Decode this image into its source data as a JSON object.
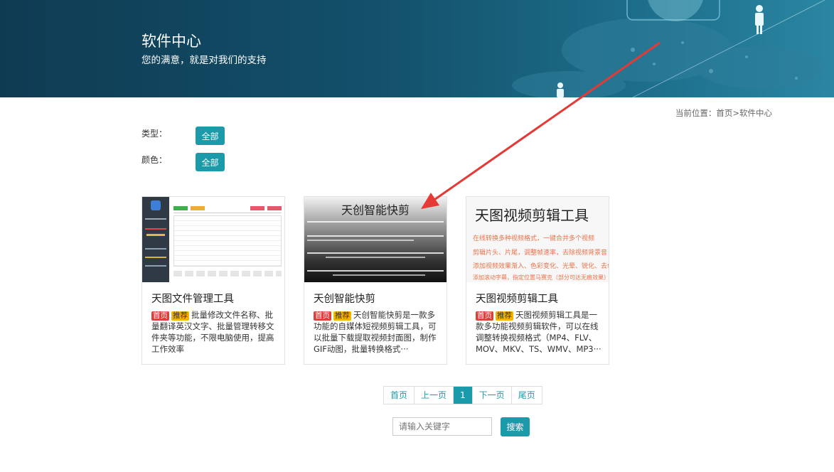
{
  "banner": {
    "title": "软件中心",
    "subtitle": "您的满意，就是对我们的支持"
  },
  "breadcrumb": {
    "prefix": "当前位置：",
    "home": "首页",
    "sep": ">",
    "current": "软件中心"
  },
  "filters": {
    "type_label": "类型：",
    "type_button": "全部",
    "color_label": "颜色：",
    "color_button": "全部"
  },
  "cards": [
    {
      "title": "天图文件管理工具",
      "tag1": "首页",
      "tag2": "推荐",
      "desc": "批量修改文件名称、批量翻译英汉文字、批量管理转移文件夹等功能，不限电脑使用，提高工作效率"
    },
    {
      "title": "天创智能快剪",
      "tag1": "首页",
      "tag2": "推荐",
      "desc": "天创智能快剪是一款多功能的自媒体短视频剪辑工具，可以批量下载提取视频封面图，制作GIF动图，批量转换格式···",
      "thumb_heading": "天创智能快剪"
    },
    {
      "title": "天图视频剪辑工具",
      "tag1": "首页",
      "tag2": "推荐",
      "desc": "天图视频剪辑工具是一款多功能视频剪辑软件，可以在线调整转换视频格式（MP4、FLV、MOV、MKV、TS、WMV、MP3···",
      "thumb_heading": "天图视频剪辑工具",
      "thumb_lines": [
        "在线转换多种视频格式，一键合并多个视频",
        "剪辑片头、片尾，调整帧速率，去除视频背景音",
        "添加视频效果渐入、色彩变化、光晕、锐化、去色",
        "添加滚动字幕，指定位置马赛克（部分可达无痕效果）"
      ]
    }
  ],
  "pagination": {
    "first": "首页",
    "prev": "上一页",
    "current": "1",
    "next": "下一页",
    "last": "尾页"
  },
  "search": {
    "placeholder": "请输入关键字",
    "button": "搜索"
  },
  "colors": {
    "accent": "#1b9aaa",
    "banner": "#13506b",
    "arrow": "#e53935"
  }
}
